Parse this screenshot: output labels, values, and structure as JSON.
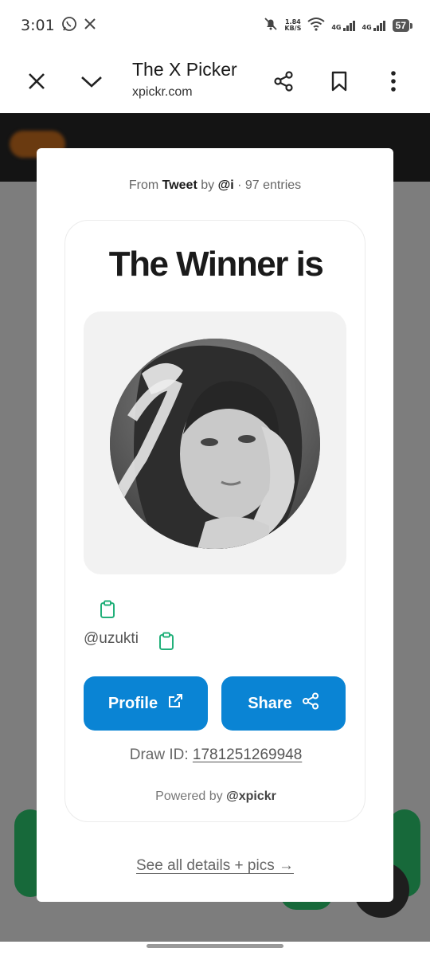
{
  "status_bar": {
    "time": "3:01",
    "speed_value": "1.84",
    "speed_unit": "KB/S",
    "signal_1": "4G",
    "signal_2": "4G",
    "battery": "57"
  },
  "browser": {
    "title": "The X Picker",
    "url": "xpickr.com"
  },
  "modal": {
    "source": {
      "from": "From",
      "tweet": "Tweet",
      "by": "by",
      "handle": "@i",
      "separator": "·",
      "entries": "97 entries"
    },
    "heading": "The Winner is",
    "username": "@uzukti",
    "profile_button": "Profile",
    "share_button": "Share",
    "draw_id_label": "Draw ID:",
    "draw_id": "1781251269948",
    "powered_by": "Powered by",
    "powered_handle": "@xpickr",
    "see_all": "See all details + pics →"
  },
  "colors": {
    "accent_button": "#0a84d4",
    "clipboard_icon": "#22b07a",
    "overlay": "#7d7d7d"
  }
}
